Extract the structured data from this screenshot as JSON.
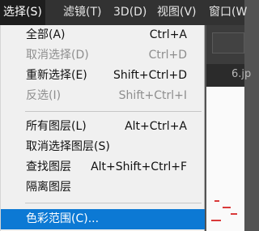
{
  "menubar": {
    "items": [
      {
        "label": "选择(S)",
        "active": true
      },
      {
        "label": "滤镜(T)"
      },
      {
        "label": "3D(D)"
      },
      {
        "label": "视图(V)"
      },
      {
        "label": "窗口(W"
      }
    ]
  },
  "background": {
    "tab_label": "6.jp"
  },
  "menu": {
    "groups": [
      [
        {
          "label": "全部(A)",
          "shortcut": "Ctrl+A",
          "disabled": false
        },
        {
          "label": "取消选择(D)",
          "shortcut": "Ctrl+D",
          "disabled": true
        },
        {
          "label": "重新选择(E)",
          "shortcut": "Shift+Ctrl+D",
          "disabled": false
        },
        {
          "label": "反选(I)",
          "shortcut": "Shift+Ctrl+I",
          "disabled": true
        }
      ],
      [
        {
          "label": "所有图层(L)",
          "shortcut": "Alt+Ctrl+A",
          "disabled": false
        },
        {
          "label": "取消选择图层(S)",
          "shortcut": "",
          "disabled": false
        },
        {
          "label": "查找图层",
          "shortcut": "Alt+Shift+Ctrl+F",
          "disabled": false
        },
        {
          "label": "隔离图层",
          "shortcut": "",
          "disabled": false
        }
      ],
      [
        {
          "label": "色彩范围(C)...",
          "shortcut": "",
          "disabled": false,
          "highlighted": true
        }
      ]
    ]
  },
  "colors": {
    "highlight": "#0c79d4",
    "menubar_bg": "#323232"
  }
}
